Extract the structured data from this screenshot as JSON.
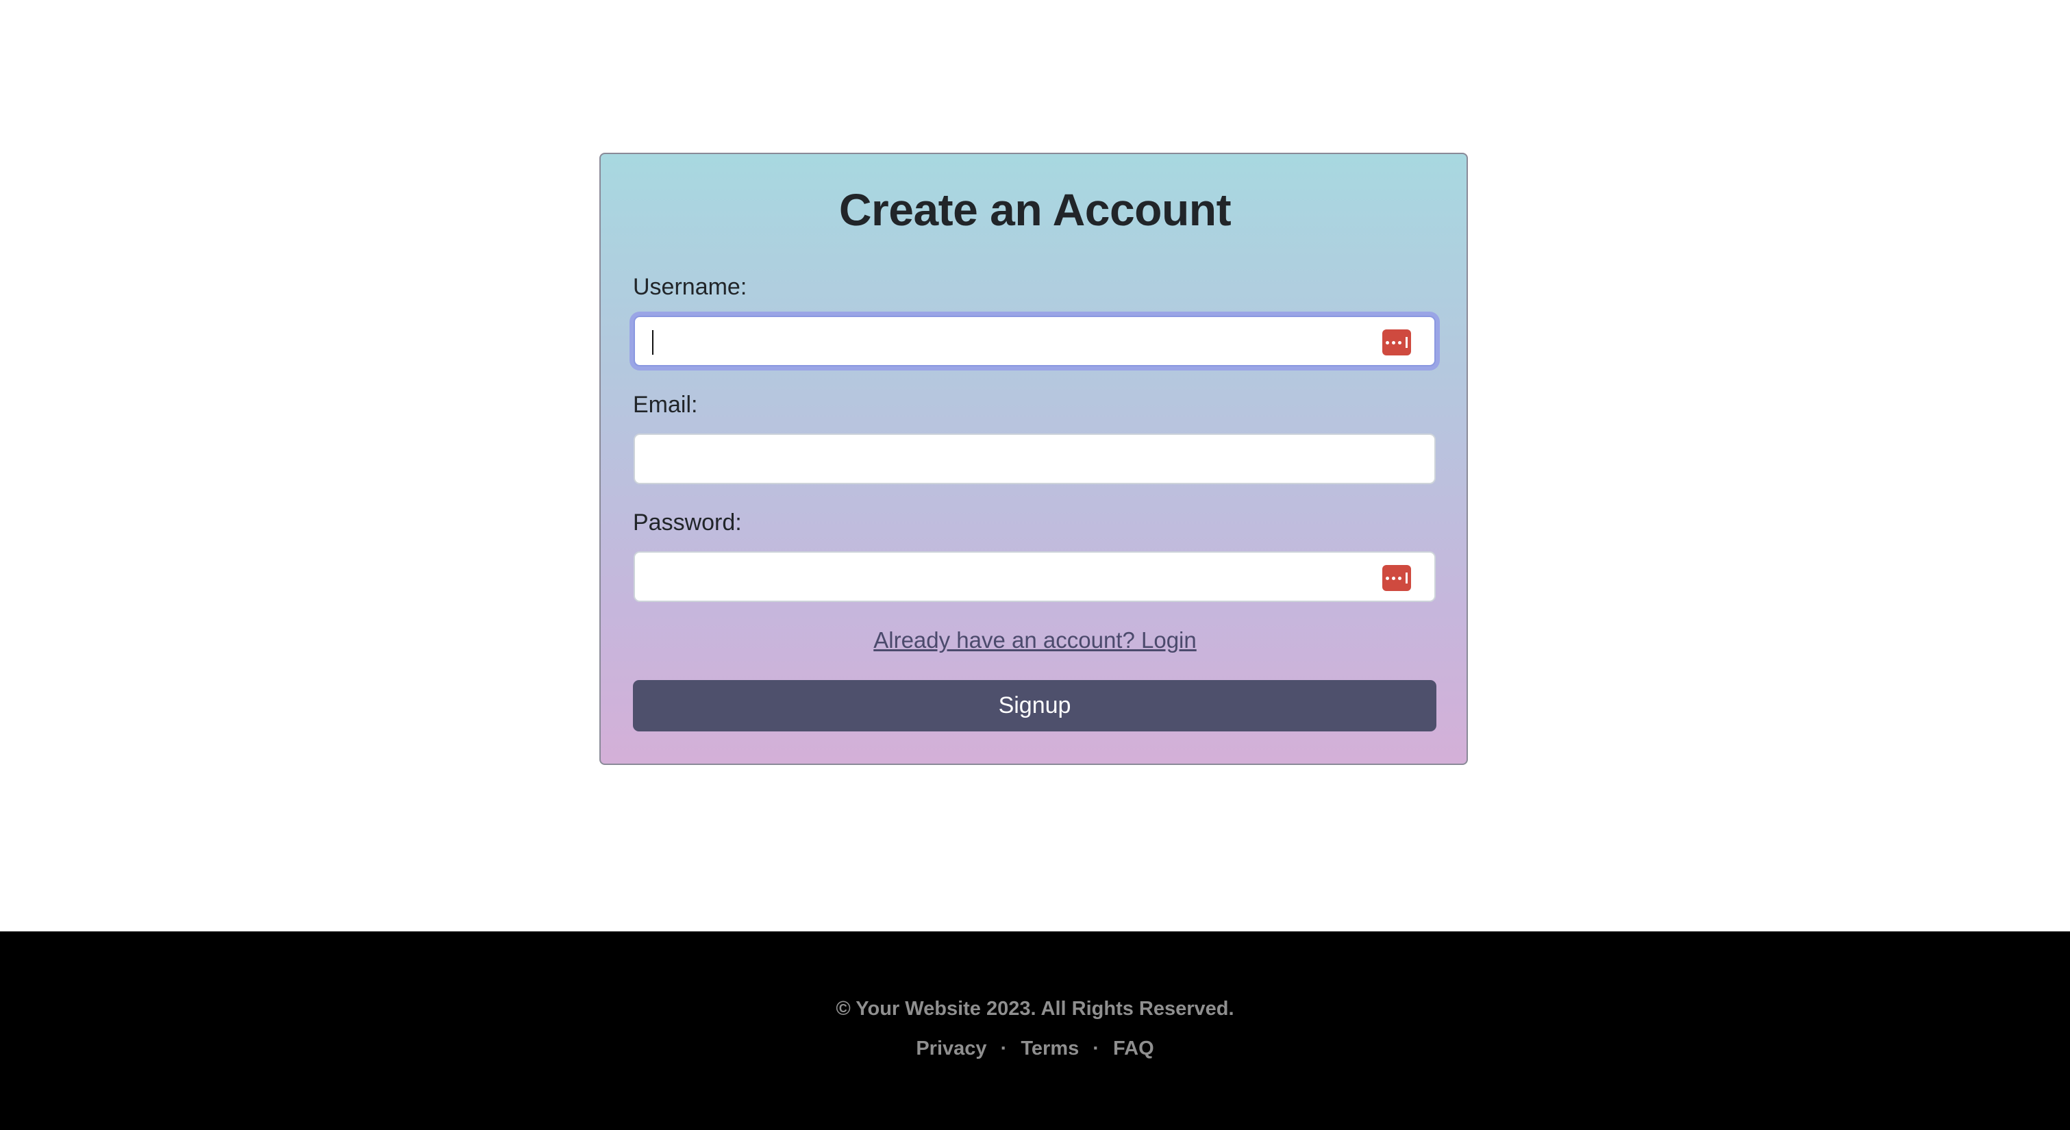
{
  "form": {
    "title": "Create an Account",
    "username_label": "Username:",
    "username_value": "",
    "email_label": "Email:",
    "email_value": "",
    "password_label": "Password:",
    "password_value": "",
    "login_link": "Already have an account? Login",
    "signup_label": "Signup",
    "focused_field": "username"
  },
  "footer": {
    "copyright": "© Your Website 2023. All Rights Reserved.",
    "links": [
      "Privacy",
      "Terms",
      "FAQ"
    ],
    "separator": "·"
  },
  "icons": {
    "password_manager": "password-manager-icon"
  },
  "colors": {
    "button": "#4e506c",
    "footer_bg": "#000000",
    "footer_text": "#8f8f8f",
    "focus_ring": "#9aa5e6",
    "password_manager_icon": "#cf4a3f",
    "card_gradient_top": "#a8d8e0",
    "card_gradient_bottom": "#d4b0d8"
  }
}
